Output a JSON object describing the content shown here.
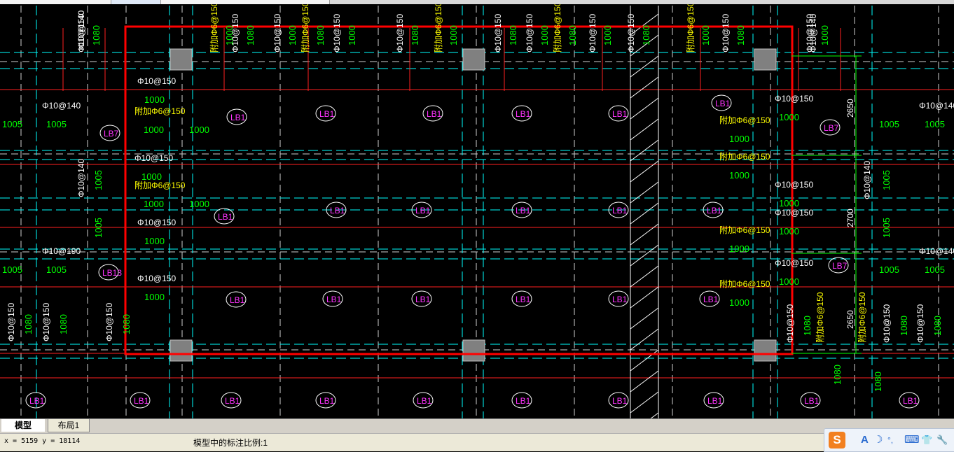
{
  "tabs": {
    "model": "模型",
    "layout": "布局1"
  },
  "status": {
    "coords": "x = 5159  y = 18114",
    "scale": "模型中的标注比例:1"
  },
  "ime": {
    "logo": "S",
    "lang": "A",
    "moon": "☽",
    "punct": "°,",
    "keyboard": "⌨",
    "skin": "👕",
    "tools": "🔧"
  },
  "colors": {
    "background": "#000000",
    "axis": "#00ffff",
    "rebar": "#ff2020",
    "selection": "#ff0000",
    "label_green": "#00ff00",
    "label_white": "#ffffff",
    "label_yellow": "#ffff00",
    "tag": "#ff33ff"
  },
  "drawing": {
    "slab_tag": "LB1",
    "side_tag": "LB7",
    "side_tag2": "LB13",
    "rebar_label": "Φ10@150",
    "rebar_label_140": "Φ10@140",
    "rebar_label_190": "Φ10@190",
    "added_rebar": "附加Φ6@150",
    "len_1000": "1000",
    "len_1005": "1005",
    "len_1080": "1080",
    "dim_2650": "2650",
    "dim_2700": "2700"
  }
}
